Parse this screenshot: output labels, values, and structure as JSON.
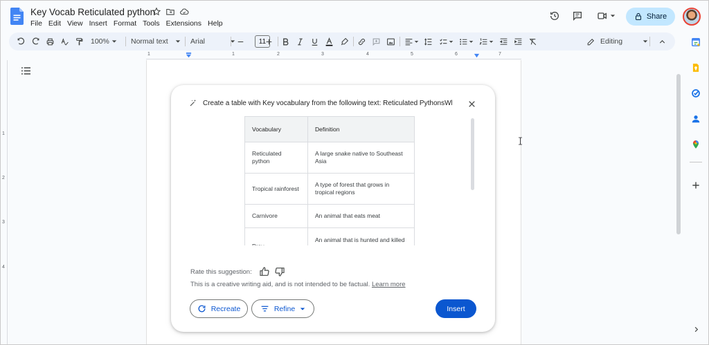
{
  "header": {
    "title": "Key Vocab Reticulated python",
    "menu": [
      "File",
      "Edit",
      "View",
      "Insert",
      "Format",
      "Tools",
      "Extensions",
      "Help"
    ],
    "share_label": "Share"
  },
  "toolbar": {
    "zoom": "100%",
    "style": "Normal text",
    "font": "Arial",
    "font_size": "11",
    "mode": "Editing"
  },
  "ruler": {
    "labels": [
      "1",
      "1",
      "2",
      "3",
      "4",
      "5",
      "6",
      "7"
    ]
  },
  "vruler": {
    "labels": [
      "1",
      "2",
      "3",
      "4"
    ]
  },
  "dialog": {
    "prompt": "Create a table with Key vocabulary from the following text: Reticulated PythonsWh",
    "table": {
      "headers": [
        "Vocabulary",
        "Definition"
      ],
      "rows": [
        {
          "term": "Reticulated python",
          "definition": "A large snake native to Southeast Asia"
        },
        {
          "term": "Tropical rainforest",
          "definition": "A type of forest that grows in tropical regions"
        },
        {
          "term": "Carnivore",
          "definition": "An animal that eats meat"
        },
        {
          "term": "Prey",
          "definition": "An animal that is hunted and killed"
        }
      ]
    },
    "rate_label": "Rate this suggestion:",
    "disclaimer": "This is a creative writing aid, and is not intended to be factual.",
    "learn_more": "Learn more",
    "recreate_label": "Recreate",
    "refine_label": "Refine",
    "insert_label": "Insert"
  },
  "colors": {
    "accent": "#0b57d0",
    "share_bg": "#c2e7ff",
    "toolbar_bg": "#edf2fa"
  }
}
